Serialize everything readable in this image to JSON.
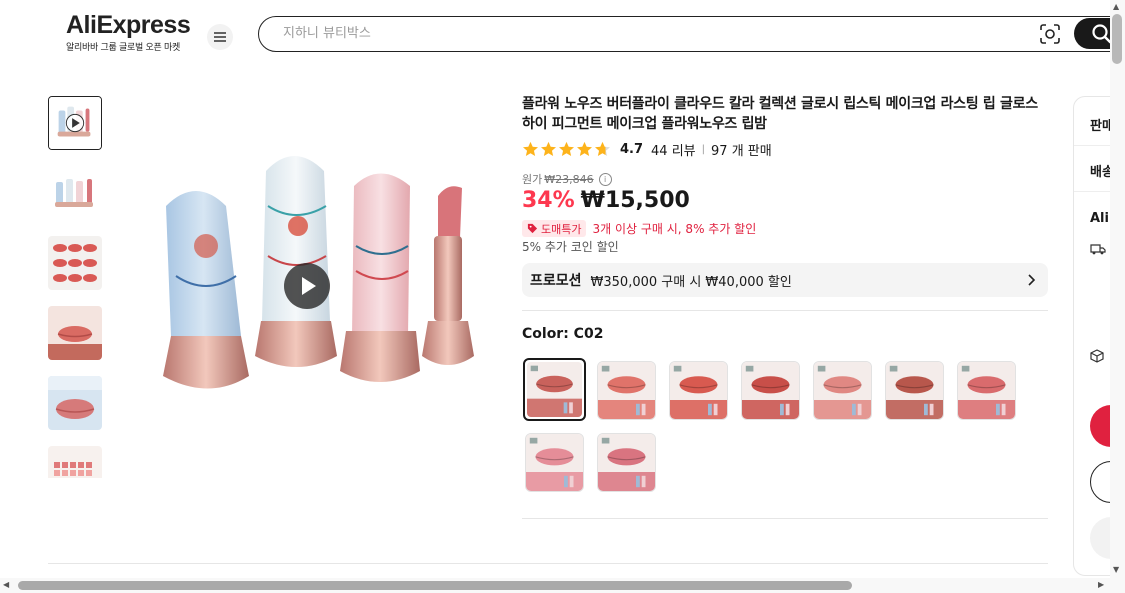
{
  "header": {
    "logo_text": "AliExpress",
    "logo_subtitle": "알리바바 그룹 글로벌 오픈 마켓",
    "search_placeholder": "지하니 뷰티박스"
  },
  "thumbnails": [
    {
      "type": "video",
      "active": true
    },
    {
      "type": "image"
    },
    {
      "type": "image"
    },
    {
      "type": "image"
    },
    {
      "type": "image"
    },
    {
      "type": "image"
    }
  ],
  "product": {
    "title": "플라워 노우즈 버터플라이 클라우드 칼라 컬렉션 글로시 립스틱 메이크업 라스팅 립 글로스 하이 피그먼트 메이크업 플라워노우즈 립밤",
    "rating": "4.7",
    "reviews": "44 리뷰",
    "sold": "97 개 판매",
    "original_label": "원가",
    "original_price": "₩23,846",
    "discount": "34%",
    "price": "₩15,500",
    "bulk_badge": "도매특가",
    "bulk_text": "3개 이상 구매 시, 8% 추가 할인",
    "coin_text": "5% 추가 코인 할인",
    "promo_label": "프로모션",
    "promo_text": "₩350,000 구매 시 ₩40,000 할인",
    "color_label": "Color: C02"
  },
  "swatches": [
    {
      "color": "#c9625c",
      "selected": true
    },
    {
      "color": "#e0736a"
    },
    {
      "color": "#d85a50"
    },
    {
      "color": "#c84f49"
    },
    {
      "color": "#e08883"
    },
    {
      "color": "#b8574c"
    },
    {
      "color": "#d96b6d"
    },
    {
      "color": "#e58d98"
    },
    {
      "color": "#d97480"
    }
  ],
  "side_panel": {
    "label1": "판매",
    "label2": "배송",
    "label3": "Ali"
  },
  "colors": {
    "accent_red": "#fd384f",
    "text_dark": "#191919"
  }
}
